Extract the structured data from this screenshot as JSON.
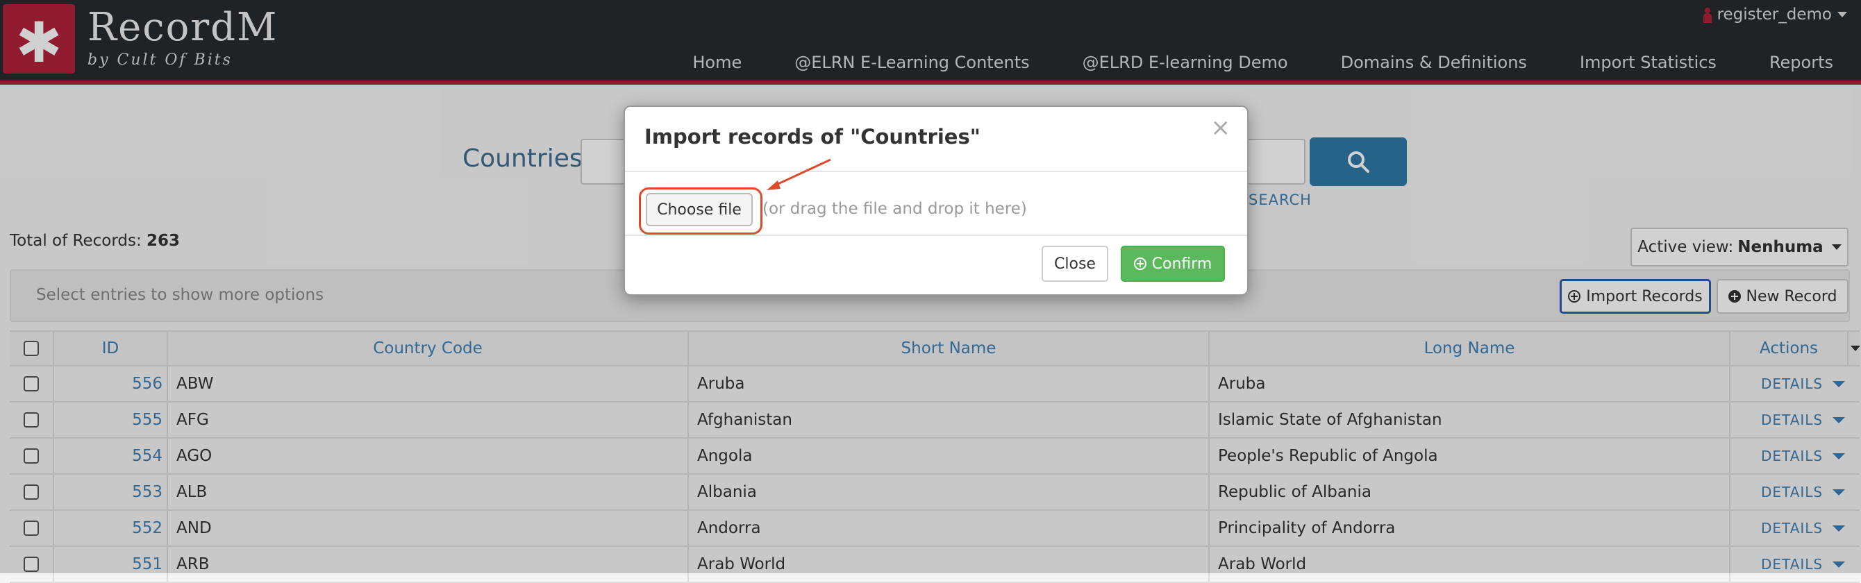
{
  "app": {
    "brand": "RecordM",
    "brand_sub": "by Cult Of Bits",
    "user": "register_demo"
  },
  "nav": [
    "Home",
    "@ELRN E-Learning Contents",
    "@ELRD E-learning Demo",
    "Domains & Definitions",
    "Import Statistics",
    "Reports"
  ],
  "search": {
    "entity": "Countries",
    "advanced": "SEARCH"
  },
  "summary": {
    "total_label": "Total of Records:",
    "total_value": "263"
  },
  "view": {
    "label": "Active view:",
    "name": "Nenhuma"
  },
  "toolbar": {
    "hint": "Select entries to show more options",
    "import_label": "Import Records",
    "new_label": "New Record"
  },
  "table": {
    "headers": [
      "ID",
      "Country Code",
      "Short Name",
      "Long Name",
      "Actions"
    ],
    "details_label": "DETAILS",
    "rows": [
      {
        "id": "556",
        "code": "ABW",
        "short": "Aruba",
        "long": "Aruba"
      },
      {
        "id": "555",
        "code": "AFG",
        "short": "Afghanistan",
        "long": "Islamic State of Afghanistan"
      },
      {
        "id": "554",
        "code": "AGO",
        "short": "Angola",
        "long": "People's Republic of Angola"
      },
      {
        "id": "553",
        "code": "ALB",
        "short": "Albania",
        "long": "Republic of Albania"
      },
      {
        "id": "552",
        "code": "AND",
        "short": "Andorra",
        "long": "Principality of Andorra"
      },
      {
        "id": "551",
        "code": "ARB",
        "short": "Arab World",
        "long": "Arab World"
      }
    ]
  },
  "modal": {
    "title": "Import records of \"Countries\"",
    "close_x": "×",
    "choose_label": "Choose file",
    "drop_hint": "(or drag the file and drop it here)",
    "close_label": "Close",
    "confirm_label": "Confirm"
  },
  "colors": {
    "brand": "#b1223a",
    "header": "#262b2e",
    "link": "#3d7fb4",
    "confirm": "#5cb85c",
    "highlight": "#e04a2b"
  }
}
